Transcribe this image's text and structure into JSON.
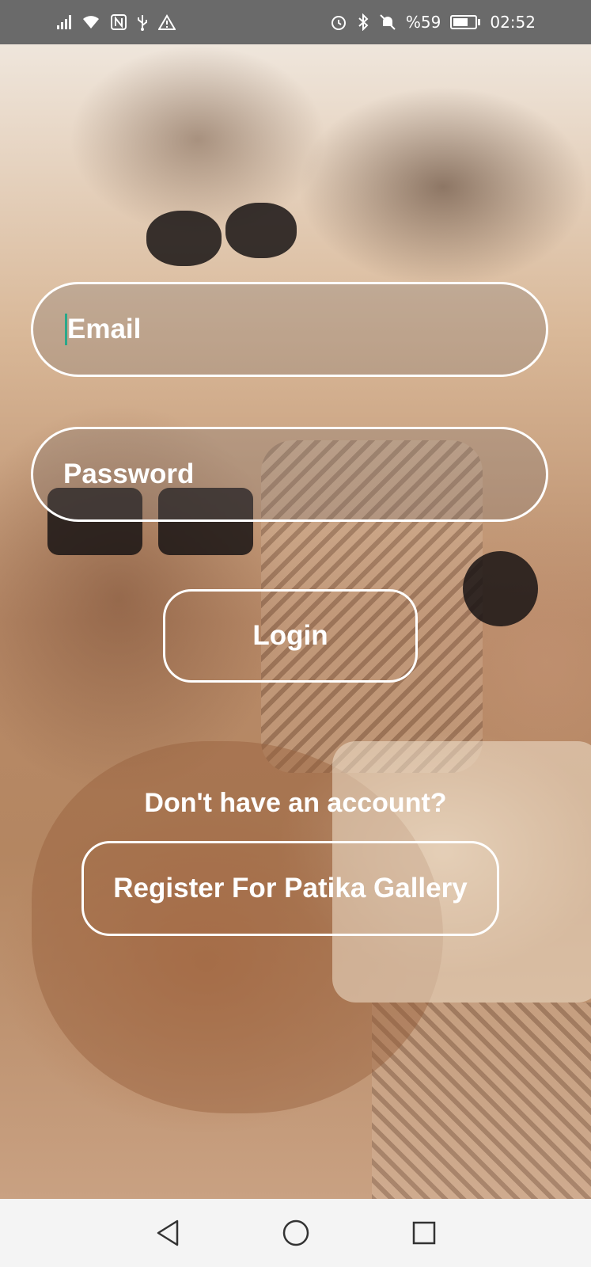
{
  "status_bar": {
    "battery_text": "%59",
    "time": "02:52",
    "battery_level": 0.59,
    "icons": [
      "signal-icon",
      "wifi-icon",
      "nfc-icon",
      "usb-icon",
      "warning-icon",
      "alarm-icon",
      "bluetooth-icon",
      "mute-icon",
      "battery-icon"
    ]
  },
  "login_form": {
    "email_placeholder": "Email",
    "password_placeholder": "Password",
    "login_label": "Login",
    "prompt_text": "Don't have an account?",
    "register_label": "Register For Patika Gallery"
  },
  "nav_bar": {
    "icons": [
      "back-icon",
      "home-icon",
      "recents-icon"
    ]
  },
  "colors": {
    "status_bar_bg": "#6a6a6a",
    "nav_bar_bg": "#f4f4f4",
    "border": "#ffffff",
    "cursor": "#2aa88a"
  }
}
